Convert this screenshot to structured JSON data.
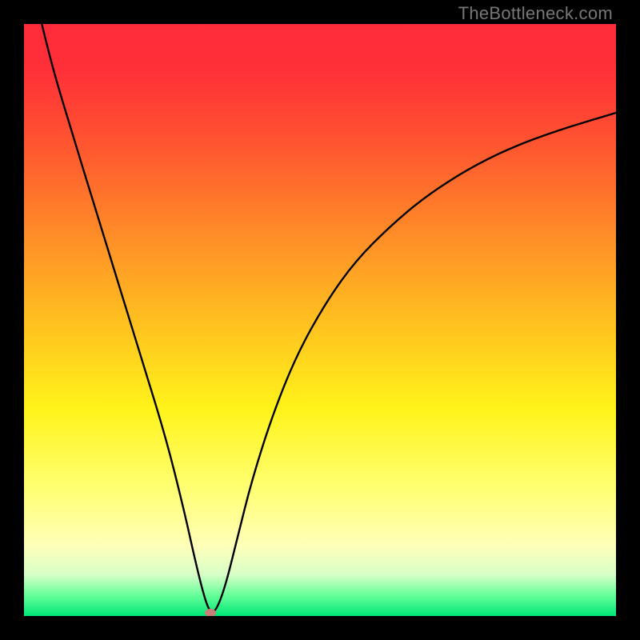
{
  "watermark": "TheBottleneck.com",
  "chart_data": {
    "type": "line",
    "title": "",
    "xlabel": "",
    "ylabel": "",
    "xlim": [
      0,
      100
    ],
    "ylim": [
      0,
      100
    ],
    "grid": false,
    "legend": false,
    "background_gradient": [
      {
        "stop": 0.0,
        "color": "#ff2b3a"
      },
      {
        "stop": 0.08,
        "color": "#ff3038"
      },
      {
        "stop": 0.2,
        "color": "#ff5430"
      },
      {
        "stop": 0.35,
        "color": "#ff8a28"
      },
      {
        "stop": 0.5,
        "color": "#ffbf20"
      },
      {
        "stop": 0.65,
        "color": "#fff31a"
      },
      {
        "stop": 0.78,
        "color": "#ffff70"
      },
      {
        "stop": 0.88,
        "color": "#ffffb8"
      },
      {
        "stop": 0.93,
        "color": "#d8ffc8"
      },
      {
        "stop": 0.965,
        "color": "#66ff99"
      },
      {
        "stop": 1.0,
        "color": "#00e676"
      }
    ],
    "series": [
      {
        "name": "bottleneck-curve",
        "color": "#000000",
        "x": [
          3,
          5,
          8,
          12,
          16,
          20,
          24,
          27,
          29,
          30.5,
          31.5,
          32.5,
          34,
          36,
          38.5,
          42,
          46,
          51,
          56,
          62,
          68,
          75,
          82,
          90,
          100
        ],
        "y": [
          100,
          92,
          82,
          69,
          56,
          43,
          30,
          18,
          9,
          3,
          0.5,
          1,
          5,
          13,
          23,
          34,
          44,
          53,
          60,
          66,
          71,
          75.5,
          79,
          82,
          85
        ]
      }
    ],
    "marker": {
      "x": 31.5,
      "y": 0.5,
      "color": "#c97f79"
    },
    "optimum_x": 31.5
  }
}
